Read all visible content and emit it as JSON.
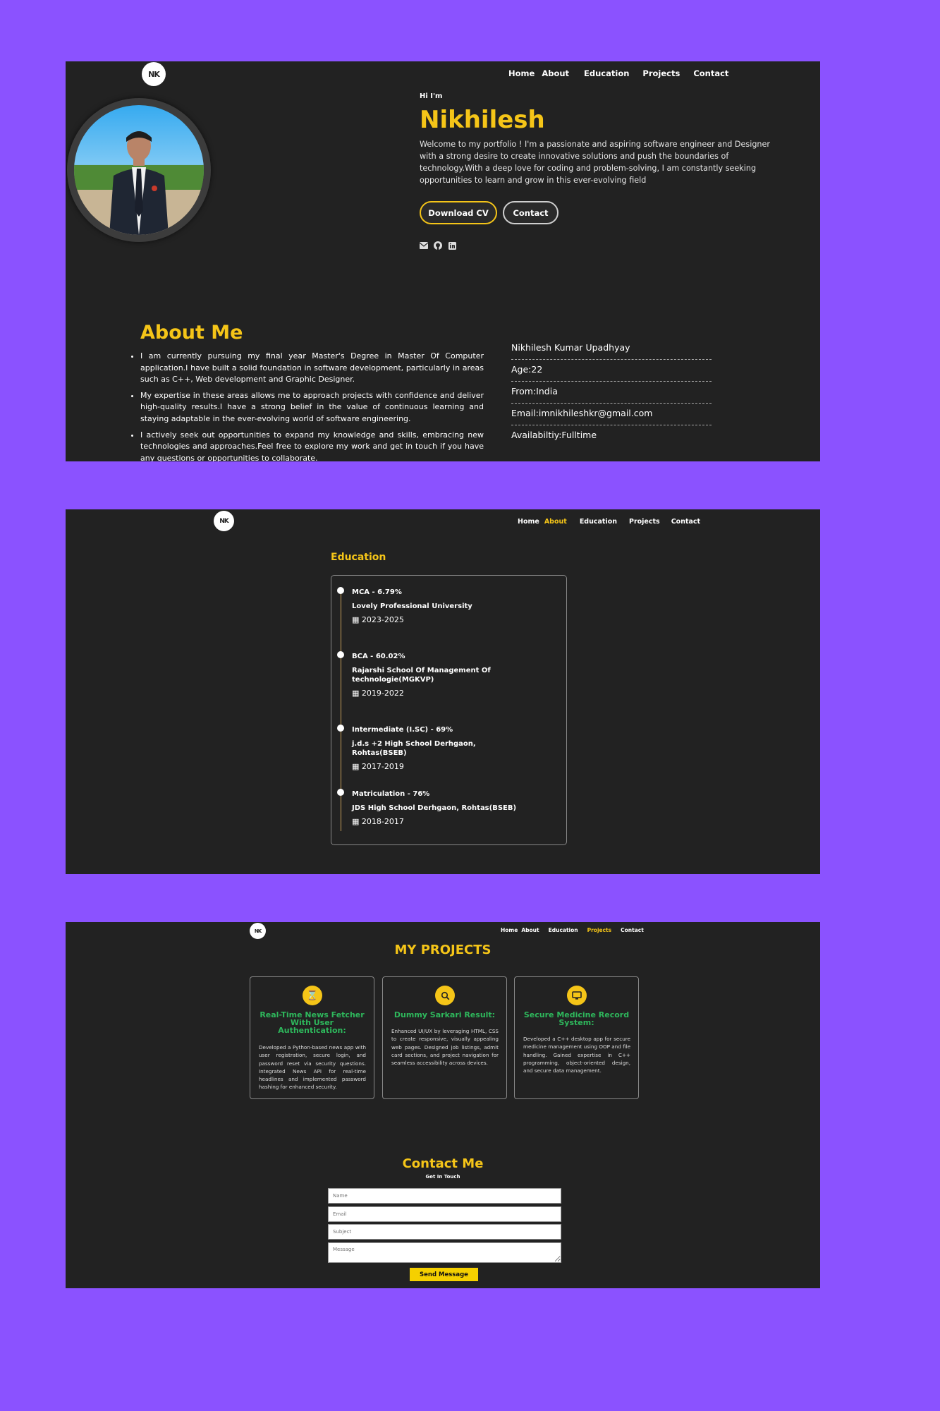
{
  "logo_text": "NK",
  "hero": {
    "nav": [
      "Home",
      "About",
      "Education",
      "Projects",
      "Contact"
    ],
    "greeting": "Hi I'm",
    "name": "Nikhilesh",
    "intro": "Welcome to my portfolio ! I'm a passionate and aspiring software engineer and Designer with a strong desire to create innovative solutions and push the boundaries of technology.With a deep love for coding and problem-solving, I am constantly seeking opportunities to learn and grow in this ever-evolving field",
    "download_cv": "Download CV",
    "contact_button": "Contact",
    "social_icons": [
      "envelope-icon",
      "github-icon",
      "linkedin-icon"
    ]
  },
  "about": {
    "title": "About Me",
    "paragraphs": [
      "I am currently pursuing my final year Master's Degree in Master Of Computer application.I have built a solid foundation in software development, particularly in areas such as C++, Web development and Graphic Designer.",
      "My expertise in these areas allows me to approach projects with confidence and deliver high-quality results.I have a strong belief in the value of continuous learning and staying adaptable in the ever-evolving world of software engineering.",
      "I actively seek out opportunities to expand my knowledge and skills, embracing new technologies and approaches.Feel free to explore my work and get in touch if you have any questions or opportunities to collaborate."
    ],
    "info": [
      "Nikhilesh Kumar Upadhyay",
      "Age:22",
      "From:India",
      "Email:imnikhileshkr@gmail.com",
      "Availabiltiy:Fulltime"
    ]
  },
  "education_page": {
    "nav": [
      "Home",
      "About",
      "Education",
      "Projects",
      "Contact"
    ],
    "active_nav": "About",
    "title": "Education",
    "items": [
      {
        "degree": "MCA - 6.79%",
        "school": "Lovely Professional University",
        "years": "2023-2025"
      },
      {
        "degree": "BCA - 60.02%",
        "school": "Rajarshi School Of Management Of technologie(MGKVP)",
        "years": "2019-2022"
      },
      {
        "degree": "Intermediate (I.SC) - 69%",
        "school": "j.d.s +2 High School Derhgaon, Rohtas(BSEB)",
        "years": "2017-2019"
      },
      {
        "degree": "Matriculation - 76%",
        "school": "JDS High School Derhgaon, Rohtas(BSEB)",
        "years": "2018-2017"
      }
    ]
  },
  "projects_page": {
    "nav": [
      "Home",
      "About",
      "Education",
      "Projects",
      "Contact"
    ],
    "active_nav": "Projects",
    "title": "MY PROJECTS",
    "projects": [
      {
        "icon": "hourglass-icon",
        "title": "Real-Time News Fetcher With User Authentication:",
        "description": "Developed a Python-based news app with user registration, secure login, and password reset via security questions. Integrated News API for real-time headlines and implemented password hashing for enhanced security."
      },
      {
        "icon": "search-icon",
        "title": "Dummy Sarkari Result:",
        "description": "Enhanced UI/UX by leveraging HTML, CSS to create responsive, visually appealing web pages. Designed job listings, admit card sections, and project navigation for seamless accessibility across devices."
      },
      {
        "icon": "monitor-icon",
        "title": "Secure Medicine Record System:",
        "description": "Developed a C++ desktop app for secure medicine management using OOP and file handling. Gained expertise in C++ programming, object-oriented design, and secure data management."
      }
    ],
    "contact": {
      "title": "Contact Me",
      "subtitle": "Get In Touch",
      "name_placeholder": "Name",
      "email_placeholder": "Email",
      "subject_placeholder": "Subject",
      "message_placeholder": "Message",
      "send_label": "Send Message"
    }
  },
  "colors": {
    "background": "#8b52ff",
    "panel": "#222222",
    "accent": "#f5c518",
    "project_title": "#2eb85c"
  }
}
